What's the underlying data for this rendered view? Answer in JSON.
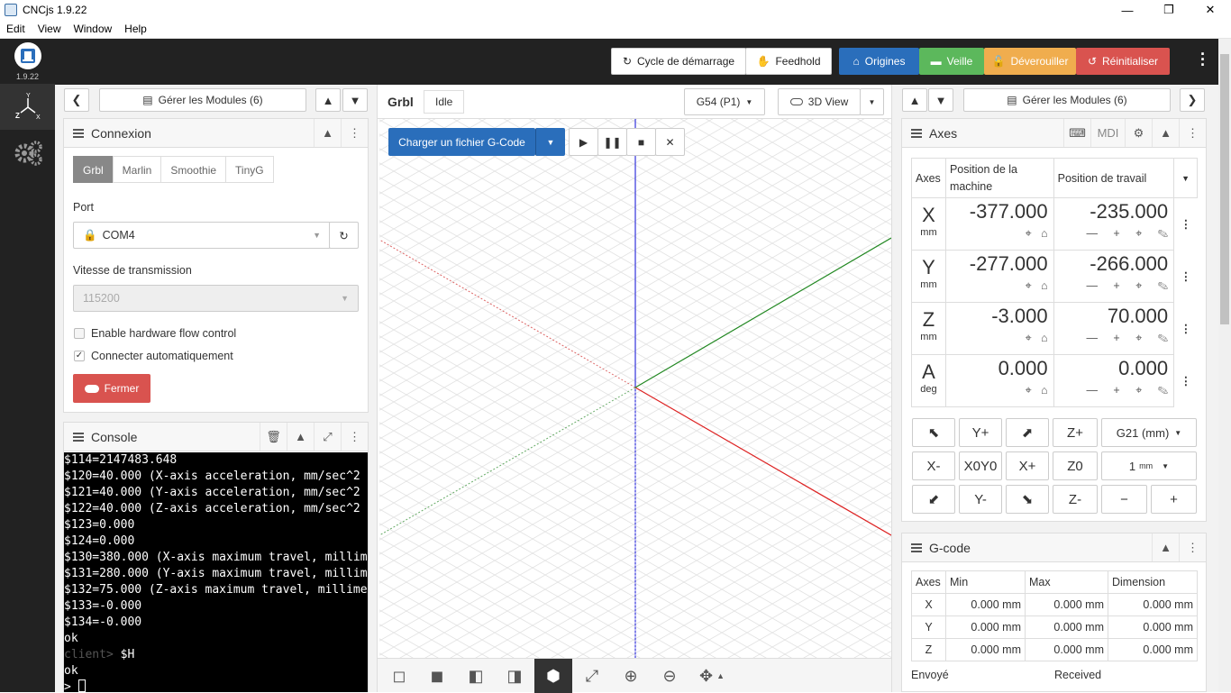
{
  "window": {
    "title": "CNCjs 1.9.22",
    "minimize": "—",
    "restore": "❐",
    "close": "✕"
  },
  "menu": [
    "Edit",
    "View",
    "Window",
    "Help"
  ],
  "sidebar": {
    "version": "1.9.22"
  },
  "toolbar": {
    "cycle_start": "Cycle de démarrage",
    "feedhold": "Feedhold",
    "home": "Origines",
    "sleep": "Veille",
    "unlock": "Déverouiller",
    "reset": "Réinitialiser"
  },
  "left": {
    "manage_modules": "Gérer les Modules (6)"
  },
  "connection": {
    "title": "Connexion",
    "tabs": [
      "Grbl",
      "Marlin",
      "Smoothie",
      "TinyG"
    ],
    "port_label": "Port",
    "port_value": "COM4",
    "baud_label": "Vitesse de transmission",
    "baud_value": "115200",
    "flow_control": "Enable hardware flow control",
    "auto_connect": "Connecter automatiquement",
    "close_button": "Fermer"
  },
  "console": {
    "title": "Console",
    "lines": [
      "$114=2147483.648",
      "$120=40.000 (X-axis acceleration, mm/sec^2",
      "$121=40.000 (Y-axis acceleration, mm/sec^2",
      "$122=40.000 (Z-axis acceleration, mm/sec^2",
      "$123=0.000",
      "$124=0.000",
      "$130=380.000 (X-axis maximum travel, millim",
      "$131=280.000 (Y-axis maximum travel, millim",
      "$132=75.000 (Z-axis maximum travel, millime",
      "$133=-0.000",
      "$134=-0.000",
      "ok"
    ],
    "prompt": "client>",
    "command": " $H",
    "after": [
      "ok"
    ],
    "input_prompt": "> "
  },
  "viewer": {
    "controller": "Grbl",
    "state": "Idle",
    "wcs": "G54 (P1)",
    "view": "3D View",
    "load_gcode": "Charger un fichier G-Code"
  },
  "right": {
    "manage_modules": "Gérer les Modules (6)"
  },
  "axes": {
    "title": "Axes",
    "mdi": "MDI",
    "col_axes": "Axes",
    "col_machine": "Position de la machine",
    "col_work": "Position de travail",
    "rows": [
      {
        "axis": "X",
        "unit": "mm",
        "machine": "-377.000",
        "work": "-235.000"
      },
      {
        "axis": "Y",
        "unit": "mm",
        "machine": "-277.000",
        "work": "-266.000"
      },
      {
        "axis": "Z",
        "unit": "mm",
        "machine": "-3.000",
        "work": "70.000"
      },
      {
        "axis": "A",
        "unit": "deg",
        "machine": "0.000",
        "work": "0.000"
      }
    ],
    "jog": {
      "yplus": "Y+",
      "zplus": "Z+",
      "units": "G21 (mm)",
      "xminus": "X-",
      "xy0": "X0Y0",
      "xplus": "X+",
      "z0": "Z0",
      "step": "1",
      "step_unit": "mm",
      "yminus": "Y-",
      "zminus": "Z-",
      "minus": "−",
      "plus": "+"
    }
  },
  "gcode": {
    "title": "G-code",
    "headers": [
      "Axes",
      "Min",
      "Max",
      "Dimension"
    ],
    "rows": [
      [
        "X",
        "0.000 mm",
        "0.000 mm",
        "0.000 mm"
      ],
      [
        "Y",
        "0.000 mm",
        "0.000 mm",
        "0.000 mm"
      ],
      [
        "Z",
        "0.000 mm",
        "0.000 mm",
        "0.000 mm"
      ]
    ],
    "sent": "Envoyé",
    "received": "Received"
  }
}
